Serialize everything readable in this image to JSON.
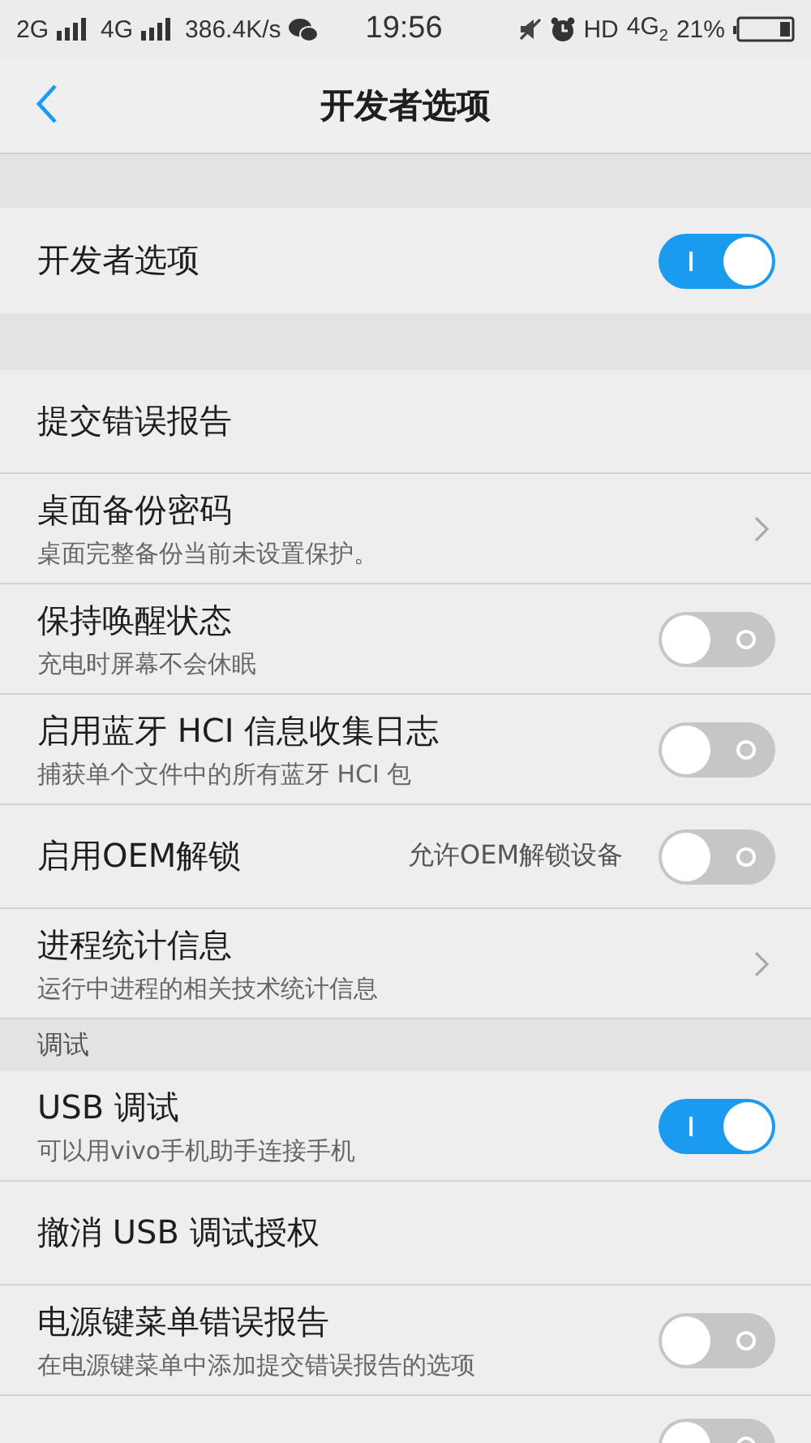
{
  "status_bar": {
    "sim1": "2G",
    "sim2": "4G",
    "speed": "386.4K/s",
    "time": "19:56",
    "hd": "HD",
    "network": "4G$_{2}$",
    "battery": "21%"
  },
  "header": {
    "title": "开发者选项"
  },
  "master": {
    "title": "开发者选项",
    "on": true
  },
  "sections": [
    {
      "items": [
        {
          "kind": "plain",
          "title": "提交错误报告"
        },
        {
          "kind": "link",
          "title": "桌面备份密码",
          "subtitle": "桌面完整备份当前未设置保护。"
        },
        {
          "kind": "toggle",
          "title": "保持唤醒状态",
          "subtitle": "充电时屏幕不会休眠",
          "on": false
        },
        {
          "kind": "toggle",
          "title": "启用蓝牙 HCI 信息收集日志",
          "subtitle": "捕获单个文件中的所有蓝牙 HCI 包",
          "on": false
        },
        {
          "kind": "toggle",
          "title": "启用OEM解锁",
          "side": "允许OEM解锁设备",
          "on": false
        },
        {
          "kind": "link",
          "title": "进程统计信息",
          "subtitle": "运行中进程的相关技术统计信息"
        }
      ]
    },
    {
      "header": "调试",
      "items": [
        {
          "kind": "toggle",
          "title": "USB 调试",
          "subtitle": "可以用vivo手机助手连接手机",
          "on": true
        },
        {
          "kind": "plain",
          "title": "撤消 USB 调试授权"
        },
        {
          "kind": "toggle",
          "title": "电源键菜单错误报告",
          "subtitle": "在电源键菜单中添加提交错误报告的选项",
          "on": false
        },
        {
          "kind": "toggle",
          "on": false
        }
      ]
    }
  ]
}
